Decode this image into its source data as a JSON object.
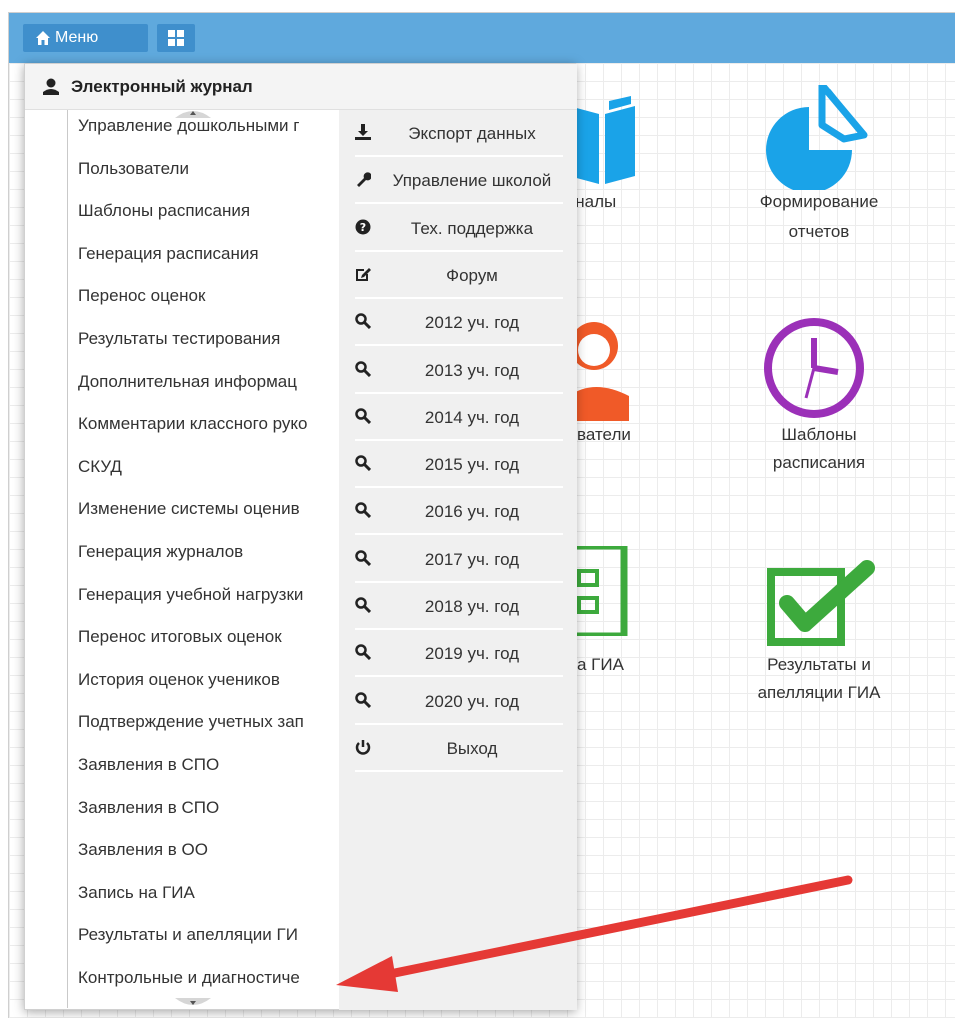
{
  "topbar": {
    "menu_label": "Меню",
    "icons": [
      "home-icon",
      "apps-grid-icon"
    ]
  },
  "background_tiles": [
    {
      "label": "Журналы",
      "visible_label": "рналы",
      "icon": "book-icon",
      "color": "#1aa3e8"
    },
    {
      "label": "Формирование отчетов",
      "line1": "Формирование",
      "line2": "отчетов",
      "icon": "pie-chart-icon",
      "color": "#1aa3e8"
    },
    {
      "label": "Пользователи",
      "visible_label": "ьзователи",
      "icon": "user-icon",
      "color": "#f05a28"
    },
    {
      "label": "Шаблоны расписания",
      "line1": "Шаблоны",
      "line2": "расписания",
      "icon": "clock-icon",
      "color": "#9b30b8"
    },
    {
      "label": "Запись на ГИА",
      "visible_label": "ь на ГИА",
      "icon": "checklist-icon",
      "color": "#3daa3d"
    },
    {
      "label": "Результаты и апелляции ГИА",
      "line1": "Результаты и",
      "line2": "апелляции ГИА",
      "icon": "checkbox-icon",
      "color": "#3daa3d"
    }
  ],
  "dropdown": {
    "header": "Электронный журнал",
    "left_items": [
      "Управление дошкольными г",
      "Пользователи",
      "Шаблоны расписания",
      "Генерация расписания",
      "Перенос оценок",
      "Результаты тестирования",
      "Дополнительная информац",
      "Комментарии классного руко",
      "СКУД",
      "Изменение системы оценив",
      "Генерация журналов",
      "Генерация учебной нагрузки",
      "Перенос итоговых оценок",
      "История оценок учеников",
      "Подтверждение учетных зап",
      "Заявления в СПО",
      "Заявления в СПО",
      "Заявления в ОО",
      "Запись на ГИА",
      "Результаты и апелляции ГИ",
      "Контрольные и диагностиче"
    ],
    "right_items": [
      {
        "label": "Экспорт данных",
        "icon": "download-icon"
      },
      {
        "label": "Управление школой",
        "icon": "wrench-icon"
      },
      {
        "label": "Тех. поддержка",
        "icon": "question-icon"
      },
      {
        "label": "Форум",
        "icon": "edit-icon"
      },
      {
        "label": "2012 уч. год",
        "icon": "search-icon"
      },
      {
        "label": "2013 уч. год",
        "icon": "search-icon"
      },
      {
        "label": "2014 уч. год",
        "icon": "search-icon"
      },
      {
        "label": "2015 уч. год",
        "icon": "search-icon"
      },
      {
        "label": "2016 уч. год",
        "icon": "search-icon"
      },
      {
        "label": "2017 уч. год",
        "icon": "search-icon"
      },
      {
        "label": "2018 уч. год",
        "icon": "search-icon"
      },
      {
        "label": "2019 уч. год",
        "icon": "search-icon"
      },
      {
        "label": "2020 уч. год",
        "icon": "search-icon"
      },
      {
        "label": "Выход",
        "icon": "power-icon"
      }
    ]
  },
  "colors": {
    "topbar": "#5fa9dd",
    "menu_button": "#3f8fcc",
    "annotation_arrow": "#e53935"
  }
}
